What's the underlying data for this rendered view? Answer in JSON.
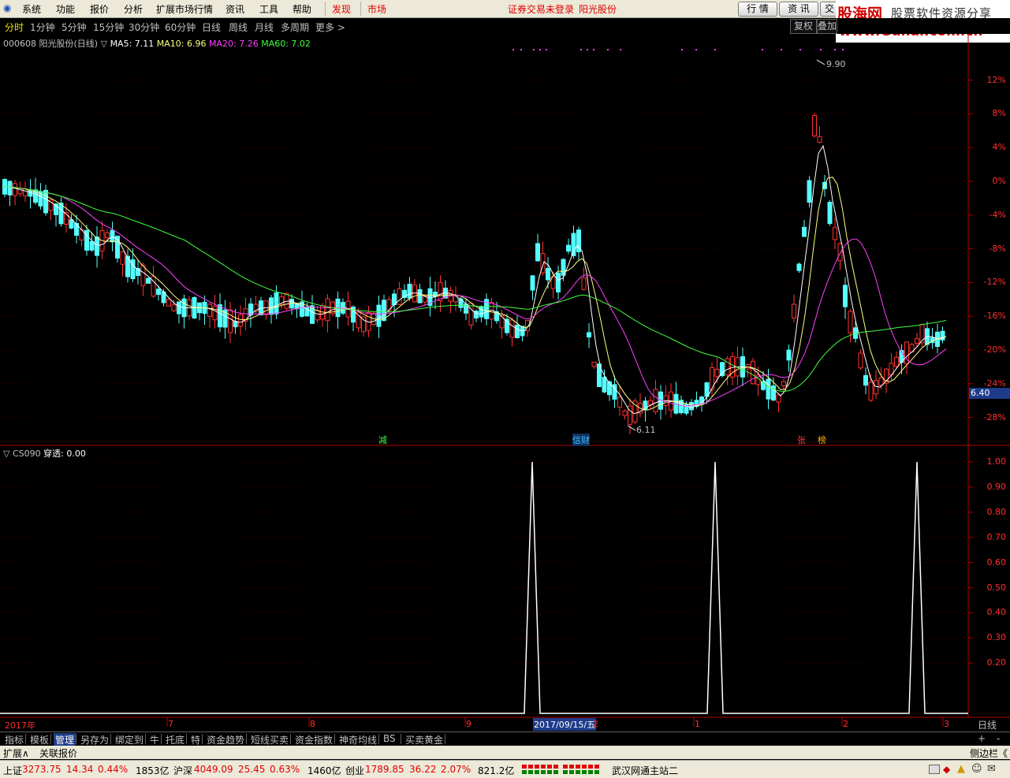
{
  "menubar": {
    "items": [
      "系统",
      "功能",
      "报价",
      "分析",
      "扩展市场行情",
      "资讯",
      "工具",
      "帮助"
    ],
    "discover": "发现",
    "market": "市场",
    "login_status": "证券交易未登录",
    "stock_name": "阳光股份",
    "btn_quote": "行 情",
    "btn_info": "资 讯",
    "btn_trade": "交"
  },
  "watermark": {
    "line1": "股海网",
    "line1b": "股票软件资源分享",
    "line2": "www.Guhai.com.cn"
  },
  "periodbar": {
    "items": [
      "分时",
      "1分钟",
      "5分钟",
      "15分钟",
      "30分钟",
      "60分钟",
      "日线",
      "周线",
      "月线",
      "多周期",
      "更多 >"
    ],
    "active": "分时",
    "btn_fuquan": "复权",
    "btn_diejia": "叠加"
  },
  "main_legend": {
    "code": "000608",
    "title": "阳光股份(日线)",
    "arrow": "▽",
    "ma5": "MA5: 7.11",
    "ma10": "MA10: 6.96",
    "ma20": "MA20: 7.26",
    "ma60": "MA60: 7.02",
    "colors": {
      "ma5": "#ffffff",
      "ma10": "#ffff80",
      "ma20": "#ff40ff",
      "ma60": "#40ff40"
    }
  },
  "price_axis": [
    "12%",
    "8%",
    "4%",
    "0%",
    "-4%",
    "-8%",
    "-12%",
    "-16%",
    "-20%",
    "-24%",
    "-28%"
  ],
  "price_tag": "6.40",
  "high_label": "9.90",
  "low_label": "6.11",
  "event_marks": [
    "减",
    "信财",
    "张",
    "榜"
  ],
  "sub_legend": {
    "arrow": "▽",
    "name": "CS090",
    "value": "穿透: 0.00"
  },
  "sub_axis": [
    "1.00",
    "0.90",
    "0.80",
    "0.70",
    "0.60",
    "0.50",
    "0.40",
    "0.30",
    "0.20"
  ],
  "time_axis": {
    "labels": [
      "2017年",
      "7",
      "8",
      "9",
      "1",
      "2",
      "3"
    ],
    "cursor": "2017/09/15/五",
    "cursor_after": "2",
    "period": "日线"
  },
  "bottom_tabs": {
    "items": [
      "指标",
      "模板",
      "管理",
      "另存为",
      "绑定到",
      "牛",
      "托底",
      "特",
      "资金趋势",
      "短线买卖",
      "资金指数",
      "神奇均线",
      "BS",
      "买卖黄金"
    ],
    "active": "管理",
    "plus": "+",
    "minus": "-"
  },
  "extbar": {
    "expand": "扩展∧",
    "linked": "关联报价",
    "sidebar": "侧边栏《"
  },
  "statusbar": {
    "sh_label": "上证",
    "sh_val": "3273.75",
    "sh_chg": "14.34",
    "sh_pct": "0.44%",
    "sh_amt": "1853亿",
    "sz_label": "沪深",
    "sz_val": "4049.09",
    "sz_chg": "25.45",
    "sz_pct": "0.63%",
    "sz_amt": "1460亿",
    "cy_label": "创业",
    "cy_val": "1789.85",
    "cy_chg": "36.22",
    "cy_pct": "2.07%",
    "cy_amt": "821.2亿",
    "server": "武汉网通主站二"
  },
  "chart_data": {
    "type": "candlestick",
    "series_names": [
      "MA5",
      "MA10",
      "MA20",
      "MA60",
      "CS090 穿透"
    ],
    "price_ylim_pct": [
      -30,
      14
    ],
    "sub_ylim": [
      0,
      1.05
    ],
    "signal_values_at_peaks": [
      1.0,
      1.0,
      1.0
    ]
  }
}
